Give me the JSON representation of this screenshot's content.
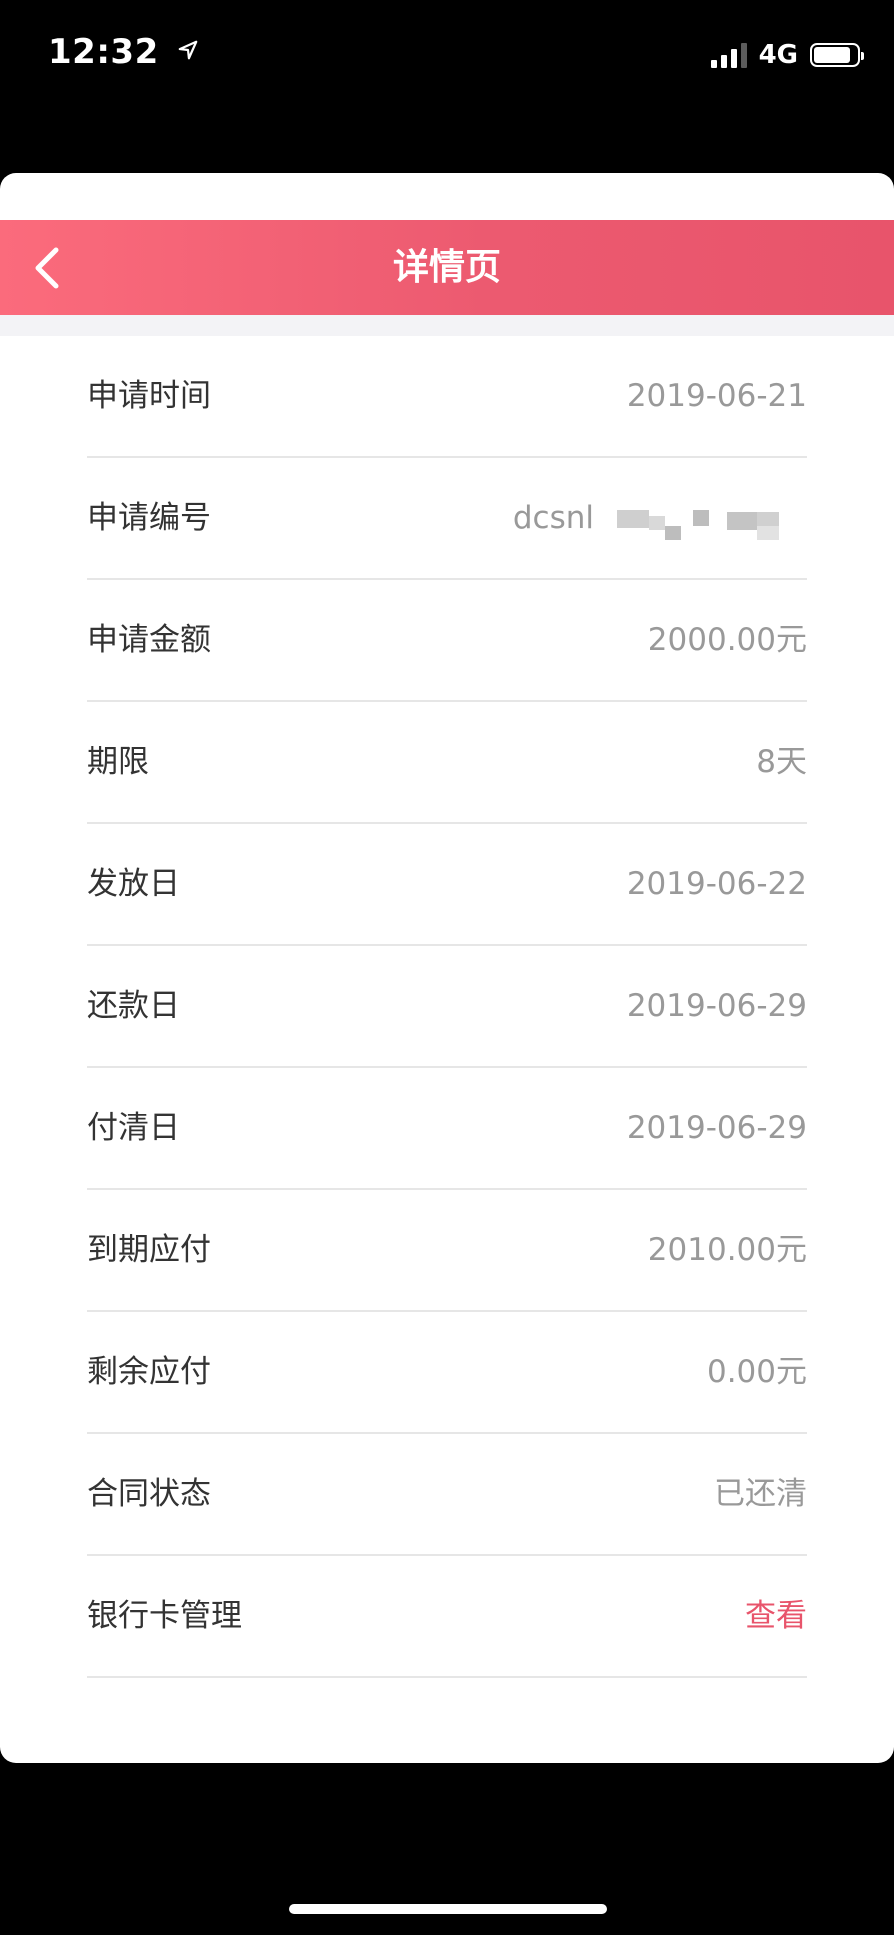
{
  "status_bar": {
    "time": "12:32",
    "network": "4G",
    "battery_level": 0.85,
    "signal_bars": 3,
    "location_icon": "location-arrow-icon",
    "signal_icon": "cellular-signal-icon",
    "battery_icon": "battery-icon"
  },
  "header": {
    "title": "详情页",
    "back_icon": "chevron-left-icon",
    "gradient": [
      "#fb6b7c",
      "#e8546b"
    ]
  },
  "details": {
    "rows": [
      {
        "label": "申请时间",
        "value": "2019-06-21"
      },
      {
        "label": "申请编号",
        "value": "dcsnl"
      },
      {
        "label": "申请金额",
        "value": "2000.00元"
      },
      {
        "label": "期限",
        "value": "8天"
      },
      {
        "label": "发放日",
        "value": "2019-06-22"
      },
      {
        "label": "还款日",
        "value": "2019-06-29"
      },
      {
        "label": "付清日",
        "value": "2019-06-29"
      },
      {
        "label": "到期应付",
        "value": "2010.00元"
      },
      {
        "label": "剩余应付",
        "value": "0.00元"
      },
      {
        "label": "合同状态",
        "value": "已还清"
      },
      {
        "label": "银行卡管理",
        "value": "查看"
      }
    ]
  },
  "colors": {
    "accent": "#e8546b",
    "label_text": "#333333",
    "value_text": "#999999",
    "divider": "#e6e6e6"
  }
}
